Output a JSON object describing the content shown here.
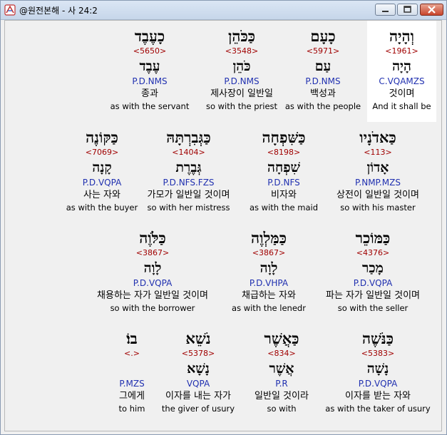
{
  "window": {
    "title": "@원전본해 - 사 24:2"
  },
  "rows": [
    [
      {
        "heb": "כָעֶבֶד",
        "num": "<5650>",
        "root": "עֶבֶד",
        "code": "P.D.NMS",
        "kor": "종과",
        "eng": "as with the servant"
      },
      {
        "heb": "כַּכֹּהֵן",
        "num": "<3548>",
        "root": "כֹּהֵן",
        "code": "P.D.NMS",
        "kor": "제사장이 일반일",
        "eng": "so with the priest"
      },
      {
        "heb": "כָעָם",
        "num": "<5971>",
        "root": "עַם",
        "code": "P.D.NMS",
        "kor": "백성과",
        "eng": "as with the people"
      },
      {
        "heb": "וְהָיָה",
        "num": "<1961>",
        "root": "הָיָה",
        "code": "C.VQAMZS",
        "kor": "것이며",
        "eng": "And it shall be"
      }
    ],
    [
      {
        "heb": "כַּקּוֹנֶה",
        "num": "<7069>",
        "root": "קָנָה",
        "code": "P.D.VQPA",
        "kor": "사는 자와",
        "eng": "as with the buyer"
      },
      {
        "heb": "כַּגְּבִרְתָּהּ",
        "num": "<1404>",
        "root": "גְּבֶרֶת",
        "code": "P.D.NFS.FZS",
        "kor": "가모가 일반일 것이며",
        "eng": "so with her mistress"
      },
      {
        "heb": "כַּשִּׁפְחָה",
        "num": "<8198>",
        "root": "שִׁפְחָה",
        "code": "P.D.NFS",
        "kor": "비자와",
        "eng": "as with the maid"
      },
      {
        "heb": "כַּאדֹנָיו",
        "num": "<113>",
        "root": "אָדוֹן",
        "code": "P.NMP.MZS",
        "kor": "상전이 일반일 것이며",
        "eng": "so with his master"
      }
    ],
    [
      {
        "heb": "כַּלֹּוֶה",
        "num": "<3867>",
        "root": "לָוָה",
        "code": "P.D.VQPA",
        "kor": "채용하는 자가 일반일 것이며",
        "eng": "so with the borrower"
      },
      {
        "heb": "כַּמַּלְוֶה",
        "num": "<3867>",
        "root": "לָוָה",
        "code": "P.D.VHPA",
        "kor": "채급하는 자와",
        "eng": "as with the lenedr"
      },
      {
        "heb": "כַּמּוֹכֵר",
        "num": "<4376>",
        "root": "מָכַר",
        "code": "P.D.VQPA",
        "kor": "파는 자가 일반일 것이며",
        "eng": "so with the seller"
      }
    ],
    [
      {
        "heb": "בוֹ׃",
        "num": "<.>",
        "root": "",
        "code": "P.MZS",
        "kor": "그에게",
        "eng": "to him"
      },
      {
        "heb": "נֹשֵׁא",
        "num": "<5378>",
        "root": "נָשָׁא",
        "code": "VQPA",
        "kor": "이자를 내는 자가",
        "eng": "the giver of usury"
      },
      {
        "heb": "כַּאֲשֶׁר",
        "num": "<834>",
        "root": "אֲשֶׁר",
        "code": "P.R",
        "kor": "일반일 것이라",
        "eng": "so with"
      },
      {
        "heb": "כַּנֹּשֶׁה",
        "num": "<5383>",
        "root": "נָשָׁה",
        "code": "P.D.VQPA",
        "kor": "이자를 받는 자와",
        "eng": "as with the taker of usury"
      }
    ]
  ]
}
